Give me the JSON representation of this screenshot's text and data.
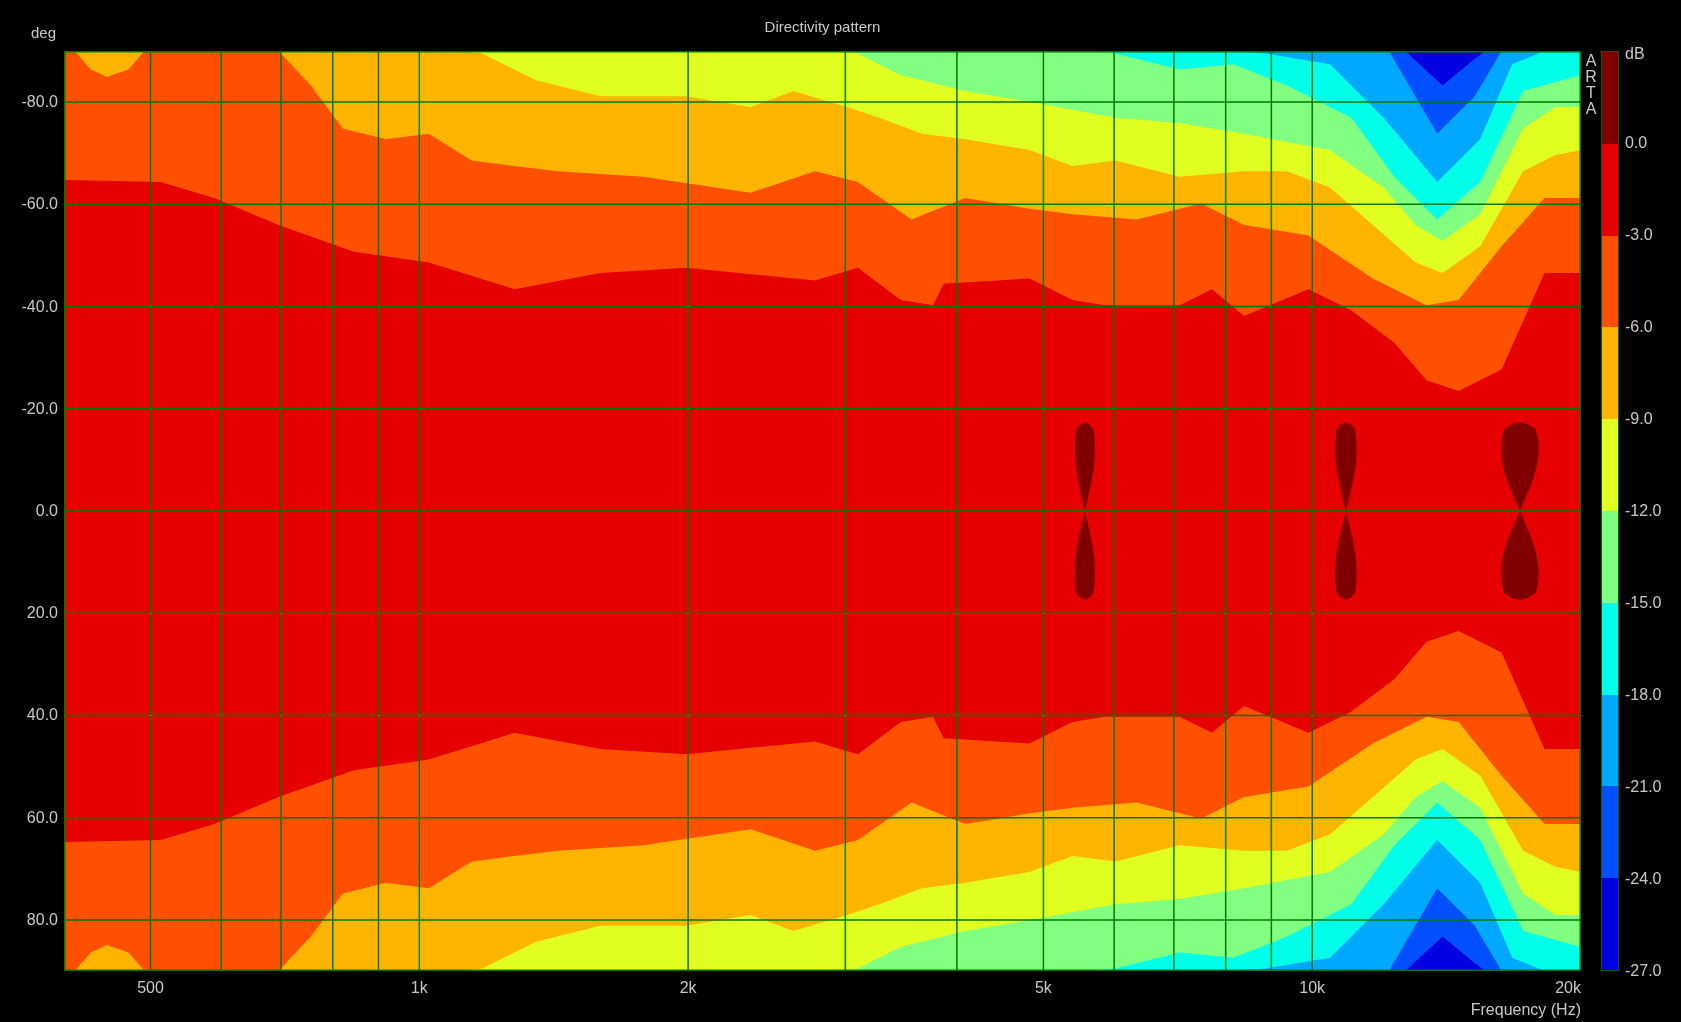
{
  "chart": {
    "title": "Directivity pattern",
    "y_axis": {
      "label": "deg",
      "ticks": [
        "-80.0",
        "-60.0",
        "-40.0",
        "-20.0",
        "0.0",
        "20.0",
        "40.0",
        "60.0",
        "80.0"
      ]
    },
    "x_axis": {
      "label": "Frequency (Hz)",
      "ticks": [
        "500",
        "1k",
        "2k",
        "5k",
        "10k",
        "20k"
      ]
    },
    "brand": "ARTA",
    "colorbar": {
      "unit": "dB",
      "bands": [
        {
          "color": "#800000"
        },
        {
          "color": "#e60000"
        },
        {
          "color": "#ff5000"
        },
        {
          "color": "#ffb400"
        },
        {
          "color": "#e0ff20"
        },
        {
          "color": "#80ff80"
        },
        {
          "color": "#00ffe8"
        },
        {
          "color": "#00a8ff"
        },
        {
          "color": "#0050ff"
        },
        {
          "color": "#0000e0"
        }
      ],
      "ticks": [
        "0.0",
        "-3.0",
        "-6.0",
        "-9.0",
        "-12.0",
        "-15.0",
        "-18.0",
        "-21.0",
        "-24.0",
        "-27.0"
      ]
    }
  }
}
